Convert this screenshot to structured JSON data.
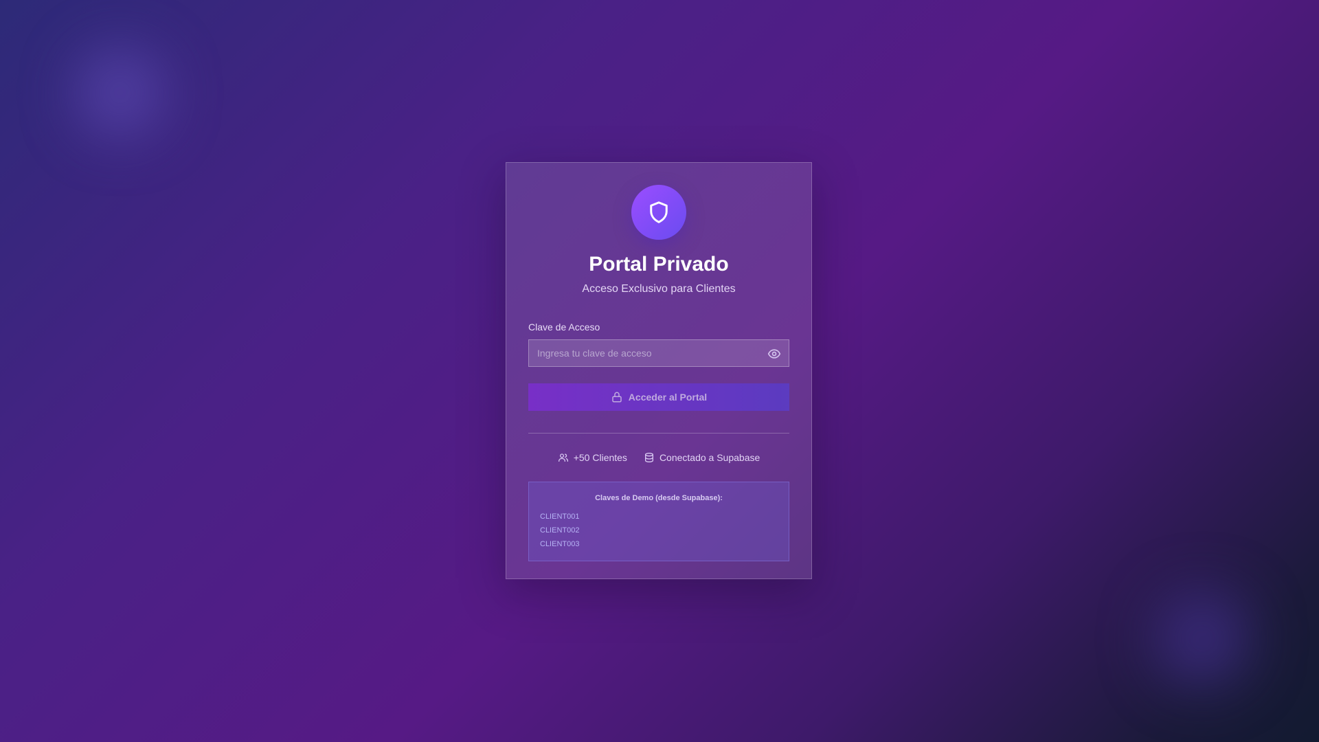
{
  "header": {
    "logo_icon": "shield-icon",
    "title": "Portal Privado",
    "subtitle": "Acceso Exclusivo para Clientes"
  },
  "form": {
    "label": "Clave de Acceso",
    "placeholder": "Ingresa tu clave de acceso",
    "value": "",
    "toggle_icon": "eye-icon",
    "submit_label": "Acceder al Portal",
    "submit_icon": "lock-icon"
  },
  "stats": [
    {
      "icon": "users-icon",
      "label": "+50 Clientes"
    },
    {
      "icon": "database-icon",
      "label": "Conectado a Supabase"
    }
  ],
  "demo": {
    "title": "Claves de Demo (desde Supabase):",
    "keys": [
      "CLIENT001",
      "CLIENT002",
      "CLIENT003"
    ]
  },
  "colors": {
    "accent_start": "#9b4dff",
    "accent_end": "#6a4cf0",
    "button_start": "#7a2fcc",
    "button_end": "#5b3cc4"
  }
}
